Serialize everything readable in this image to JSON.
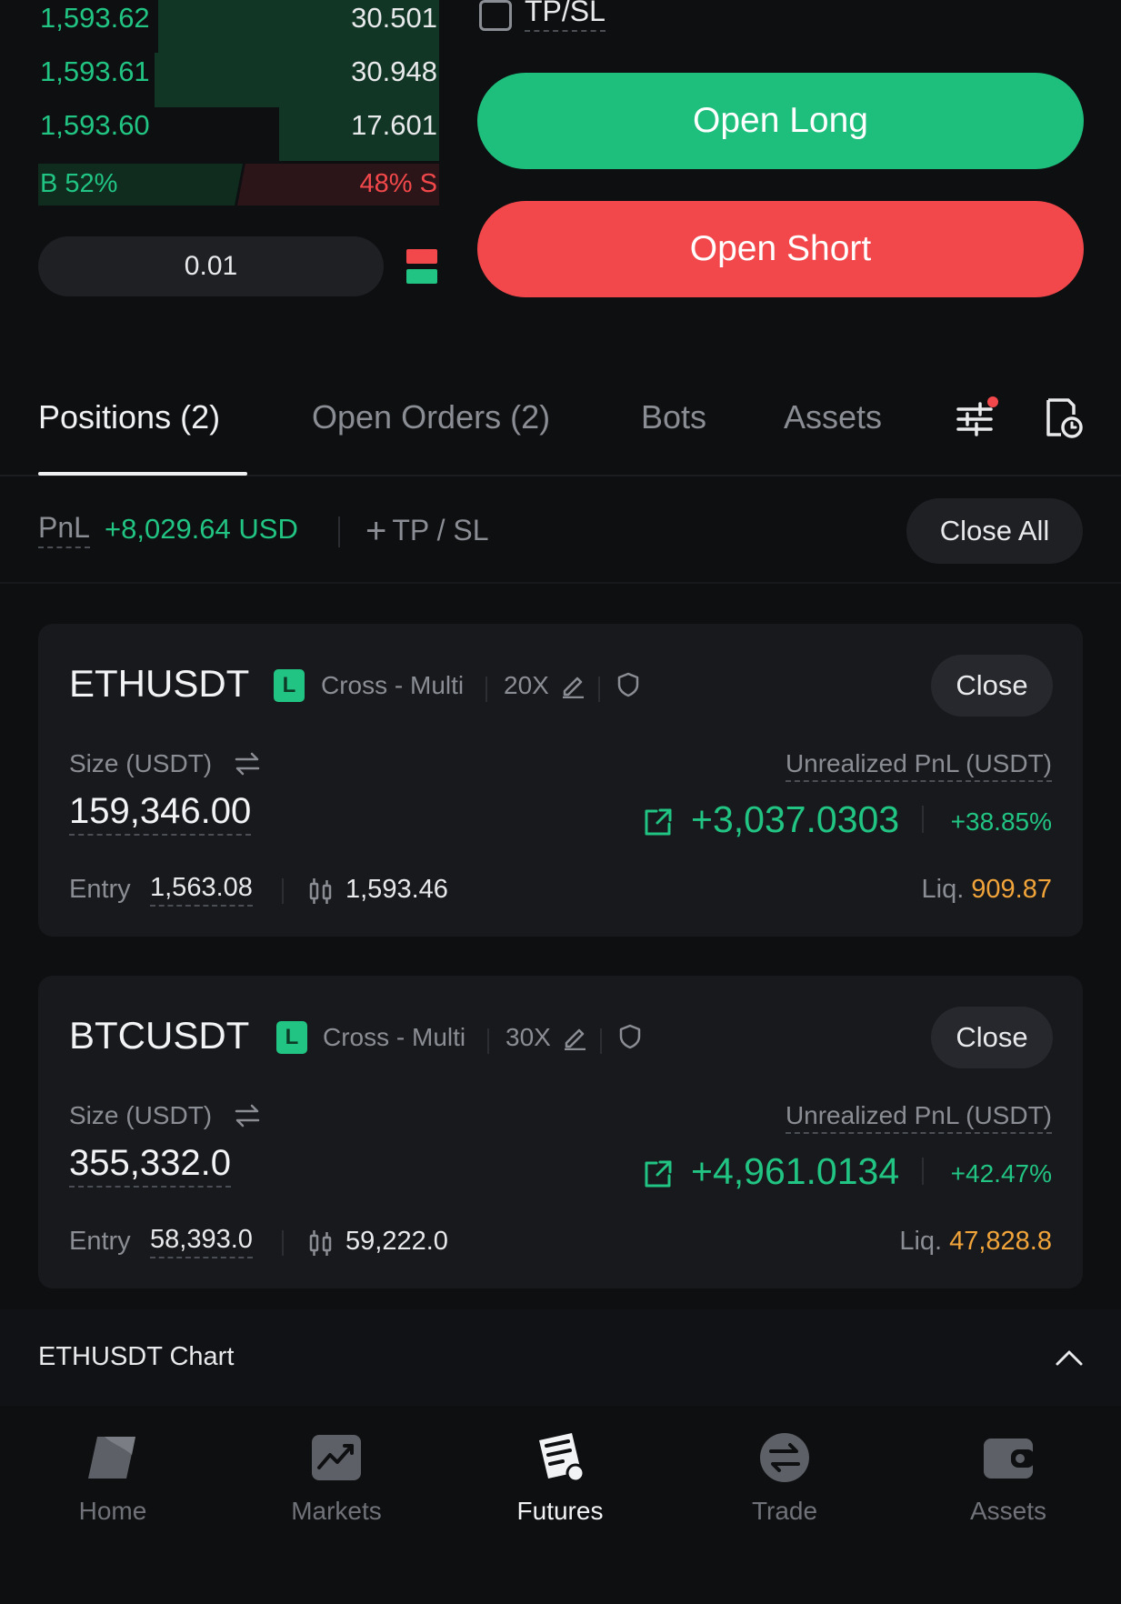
{
  "orderbook": {
    "rows": [
      {
        "price": "1,593.62",
        "qty": "30.501",
        "fill": 0.7
      },
      {
        "price": "1,593.61",
        "qty": "30.948",
        "fill": 0.71
      },
      {
        "price": "1,593.60",
        "qty": "17.601",
        "fill": 0.4
      }
    ],
    "buy_ratio": "B 52%",
    "sell_ratio": "48% S",
    "quantity": "0.01"
  },
  "order": {
    "tpsl_label": "TP/SL",
    "open_long": "Open Long",
    "open_short": "Open Short"
  },
  "tabs": [
    {
      "label": "Positions (2)",
      "active": true
    },
    {
      "label": "Open Orders (2)",
      "active": false
    },
    {
      "label": "Bots",
      "active": false
    },
    {
      "label": "Assets",
      "active": false
    }
  ],
  "pnl": {
    "label": "PnL",
    "value": "+8,029.64 USD",
    "tpsl_add": "TP / SL",
    "close_all": "Close All"
  },
  "positions": [
    {
      "symbol": "ETHUSDT",
      "side": "L",
      "margin_mode": "Cross - Multi",
      "leverage": "20X",
      "close": "Close",
      "size_label": "Size (USDT)",
      "size": "159,346.00",
      "upnl_label": "Unrealized PnL (USDT)",
      "upnl": "+3,037.0303",
      "upnl_pct": "+38.85%",
      "entry_label": "Entry",
      "entry": "1,563.08",
      "mark": "1,593.46",
      "liq_label": "Liq.",
      "liq": "909.87"
    },
    {
      "symbol": "BTCUSDT",
      "side": "L",
      "margin_mode": "Cross - Multi",
      "leverage": "30X",
      "close": "Close",
      "size_label": "Size (USDT)",
      "size": "355,332.0",
      "upnl_label": "Unrealized PnL (USDT)",
      "upnl": "+4,961.0134",
      "upnl_pct": "+42.47%",
      "entry_label": "Entry",
      "entry": "58,393.0",
      "mark": "59,222.0",
      "liq_label": "Liq.",
      "liq": "47,828.8"
    }
  ],
  "chart": {
    "title": "ETHUSDT Chart"
  },
  "nav": [
    {
      "label": "Home",
      "icon": "home-icon",
      "active": false
    },
    {
      "label": "Markets",
      "icon": "markets-icon",
      "active": false
    },
    {
      "label": "Futures",
      "icon": "futures-icon",
      "active": true
    },
    {
      "label": "Trade",
      "icon": "trade-icon",
      "active": false
    },
    {
      "label": "Assets",
      "icon": "wallet-icon",
      "active": false
    }
  ],
  "colors": {
    "background": "#0e0f11",
    "green": "#21c482",
    "red": "#f2484b",
    "orange": "#f0a43a",
    "card": "#18191d"
  }
}
